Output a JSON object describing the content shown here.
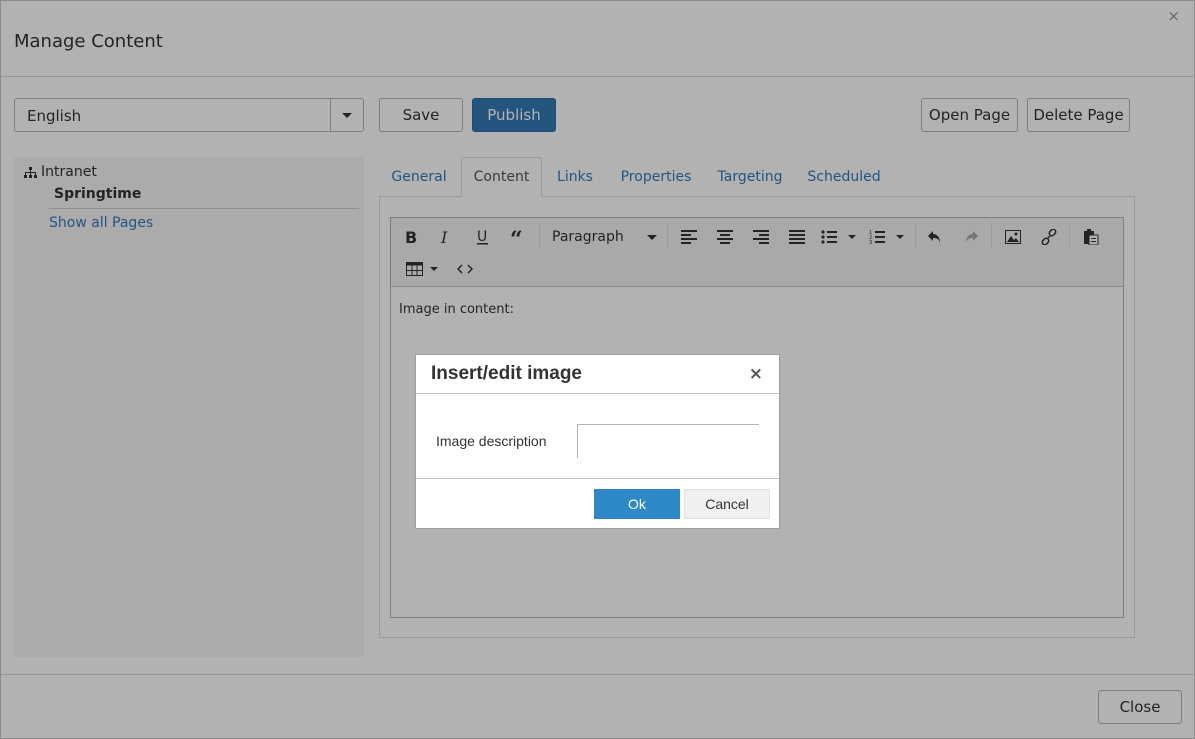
{
  "window": {
    "title": "Manage Content",
    "close_glyph": "×"
  },
  "language_select": {
    "value": "English"
  },
  "actions": {
    "save": "Save",
    "publish": "Publish",
    "open_page": "Open Page",
    "delete_page": "Delete Page"
  },
  "sidebar": {
    "root": "Intranet",
    "child": "Springtime",
    "show_all": "Show all Pages"
  },
  "tabs": [
    {
      "label": "General"
    },
    {
      "label": "Content",
      "active": true
    },
    {
      "label": "Links"
    },
    {
      "label": "Properties"
    },
    {
      "label": "Targeting"
    },
    {
      "label": "Scheduled"
    }
  ],
  "editor": {
    "format_select": "Paragraph",
    "content": "Image in content:",
    "toolbar_icons": [
      "bold-icon",
      "italic-icon",
      "underline-icon",
      "blockquote-icon",
      "align-left-icon",
      "align-center-icon",
      "align-right-icon",
      "align-justify-icon",
      "bullet-list-icon",
      "numbered-list-icon",
      "undo-icon",
      "redo-icon",
      "image-icon",
      "link-icon",
      "paste-icon",
      "table-icon",
      "code-icon"
    ]
  },
  "footer": {
    "close": "Close"
  },
  "dialog": {
    "title": "Insert/edit image",
    "close_glyph": "×",
    "field_label": "Image description",
    "field_value": "",
    "ok": "Ok",
    "cancel": "Cancel"
  },
  "colors": {
    "primary": "#337ab7",
    "dialog_ok": "#2d8ac7",
    "link": "#337ab7"
  }
}
